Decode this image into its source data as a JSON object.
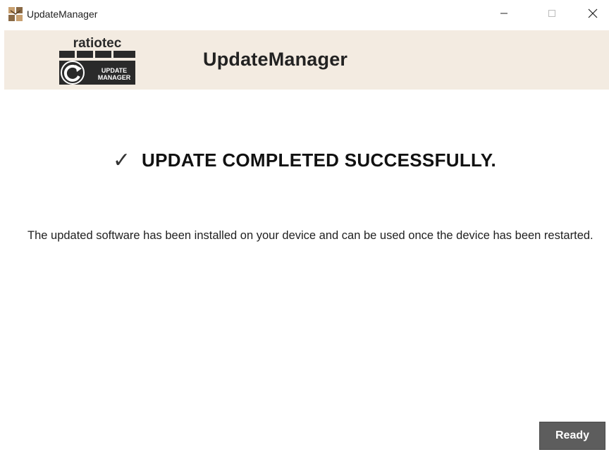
{
  "window": {
    "title": "UpdateManager",
    "controls": {
      "minimize": "–",
      "maximize": "□",
      "close": "✕"
    }
  },
  "banner": {
    "logo_brand": "ratiotec",
    "logo_badge_line1": "UPDATE",
    "logo_badge_line2": "MANAGER",
    "title": "UpdateManager",
    "background": "#f3ebe1"
  },
  "status": {
    "icon": "checkmark-icon",
    "glyph": "✓",
    "text": "UPDATE COMPLETED SUCCESSFULLY."
  },
  "message": {
    "text": "The updated software has been installed on your device and can be used once the device has been restarted."
  },
  "actions": {
    "ready_label": "Ready",
    "ready_color": "#5d5d5d"
  }
}
